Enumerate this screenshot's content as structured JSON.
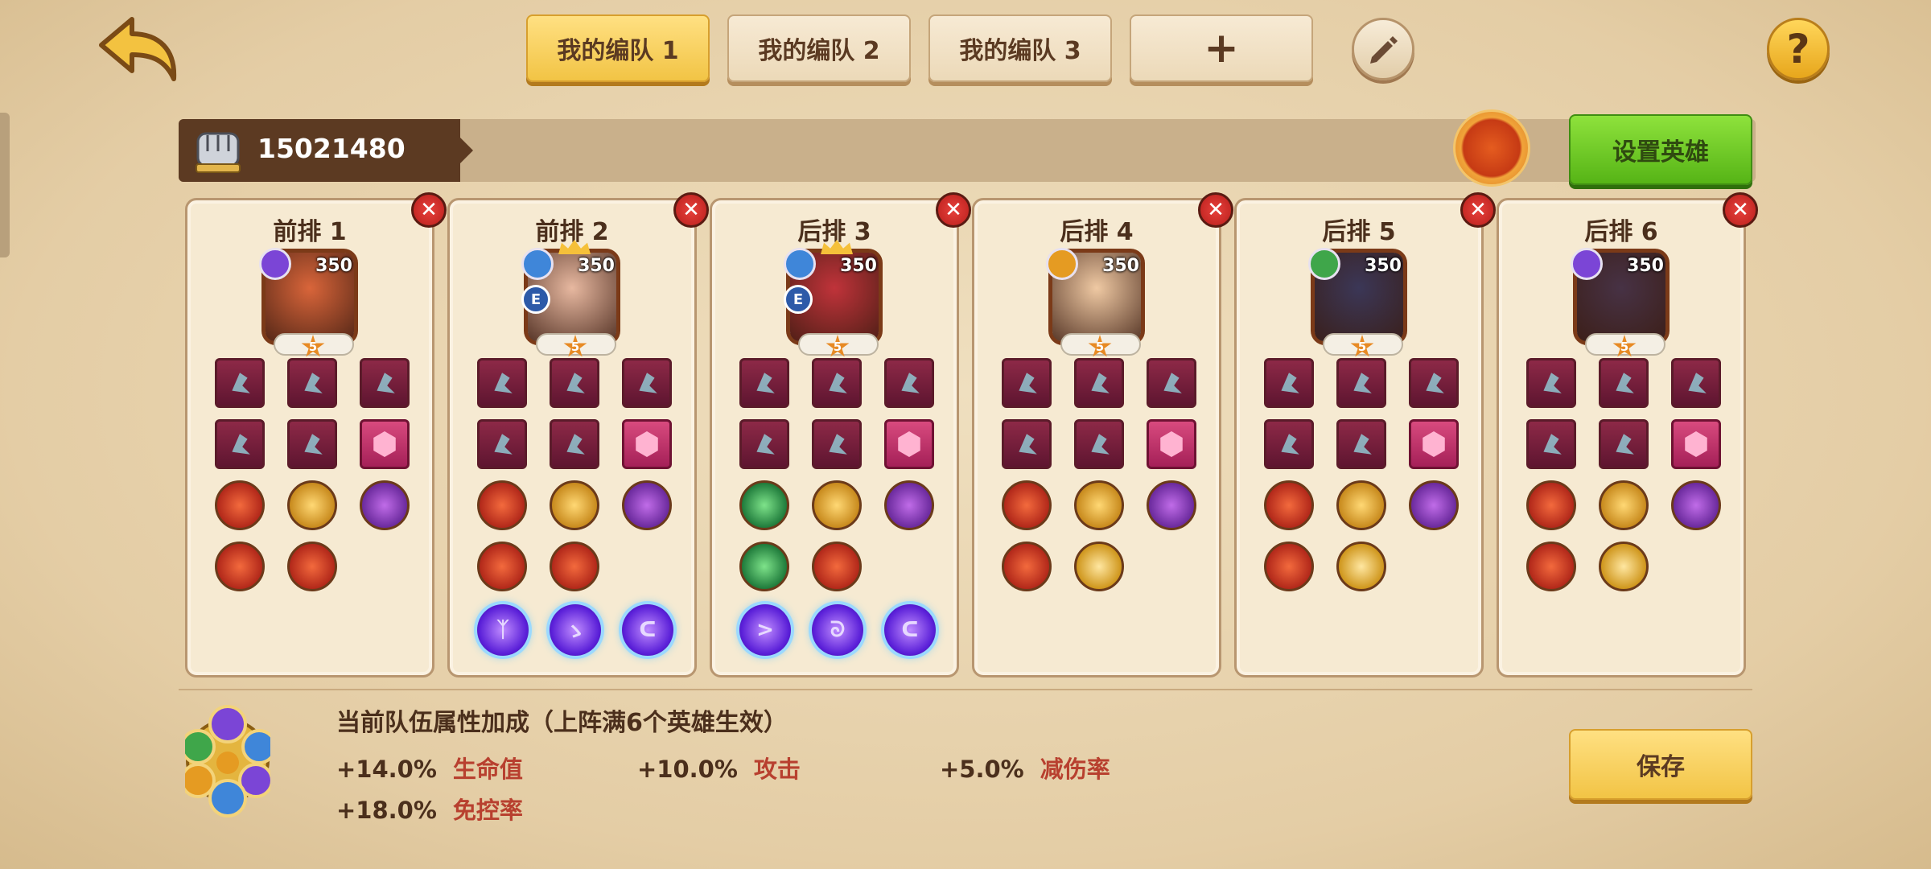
{
  "tabs": [
    {
      "label": "我的编队 1",
      "active": true
    },
    {
      "label": "我的编队 2",
      "active": false
    },
    {
      "label": "我的编队 3",
      "active": false
    },
    {
      "label": "+",
      "active": false
    }
  ],
  "power": {
    "value": "15021480",
    "icon": "fist-icon"
  },
  "buttons": {
    "set_hero": "设置英雄",
    "save": "保存",
    "help": "?"
  },
  "colors": {
    "accent_yellow": "#f2c445",
    "accent_green": "#56b416",
    "panel_bg": "#f6ead2",
    "stat_name": "#b8402f"
  },
  "heroes": [
    {
      "title": "前排 1",
      "level": "350",
      "stars": "5",
      "faction_color": "#7b45d6",
      "face": "#d9653a",
      "crown": false,
      "ebadge": "",
      "equip_row1": [
        "normal",
        "normal",
        "normal"
      ],
      "equip_row2": [
        "normal",
        "normal",
        "pink"
      ],
      "runes_row1": [
        "red",
        "gold",
        "purple"
      ],
      "runes_row2": [
        "red",
        "red"
      ],
      "orbs": []
    },
    {
      "title": "前排 2",
      "level": "350",
      "stars": "5",
      "faction_color": "#3f86d9",
      "face": "#e7b8a0",
      "crown": true,
      "ebadge": "E",
      "equip_row1": [
        "normal",
        "normal",
        "normal"
      ],
      "equip_row2": [
        "normal",
        "normal",
        "pink"
      ],
      "runes_row1": [
        "red",
        "gold",
        "purple"
      ],
      "runes_row2": [
        "red",
        "red"
      ],
      "orbs": [
        "ᛉ",
        "ゝ",
        "ᑕ"
      ]
    },
    {
      "title": "后排 3",
      "level": "350",
      "stars": "5",
      "faction_color": "#3f86d9",
      "face": "#c0333a",
      "crown": true,
      "ebadge": "E",
      "equip_row1": [
        "normal",
        "normal",
        "normal"
      ],
      "equip_row2": [
        "normal",
        "normal",
        "pink"
      ],
      "runes_row1": [
        "green",
        "gold",
        "purple"
      ],
      "runes_row2": [
        "green",
        "red"
      ],
      "orbs": [
        ">",
        "ᘐ",
        "ᑕ"
      ]
    },
    {
      "title": "后排 4",
      "level": "350",
      "stars": "5",
      "faction_color": "#e59b22",
      "face": "#efc9a3",
      "crown": false,
      "ebadge": "",
      "equip_row1": [
        "normal",
        "normal",
        "normal"
      ],
      "equip_row2": [
        "normal",
        "normal",
        "pink"
      ],
      "runes_row1": [
        "red",
        "gold",
        "purple"
      ],
      "runes_row2": [
        "red",
        "wing"
      ],
      "orbs": []
    },
    {
      "title": "后排 5",
      "level": "350",
      "stars": "5",
      "faction_color": "#3fa64a",
      "face": "#3b3757",
      "crown": false,
      "ebadge": "",
      "equip_row1": [
        "normal",
        "normal",
        "normal"
      ],
      "equip_row2": [
        "normal",
        "normal",
        "pink"
      ],
      "runes_row1": [
        "red",
        "gold",
        "purple"
      ],
      "runes_row2": [
        "red",
        "wing"
      ],
      "orbs": []
    },
    {
      "title": "后排 6",
      "level": "350",
      "stars": "5",
      "faction_color": "#7b45d6",
      "face": "#473245",
      "crown": false,
      "ebadge": "",
      "equip_row1": [
        "normal",
        "normal",
        "normal"
      ],
      "equip_row2": [
        "normal",
        "normal",
        "pink"
      ],
      "runes_row1": [
        "red",
        "gold",
        "purple"
      ],
      "runes_row2": [
        "red",
        "wing"
      ],
      "orbs": []
    }
  ],
  "bonus": {
    "title": "当前队伍属性加成（上阵满6个英雄生效）",
    "stats": [
      {
        "value": "+14.0%",
        "name": "生命值"
      },
      {
        "value": "+10.0%",
        "name": "攻击"
      },
      {
        "value": "+5.0%",
        "name": "减伤率"
      },
      {
        "value": "+18.0%",
        "name": "免控率"
      }
    ]
  }
}
